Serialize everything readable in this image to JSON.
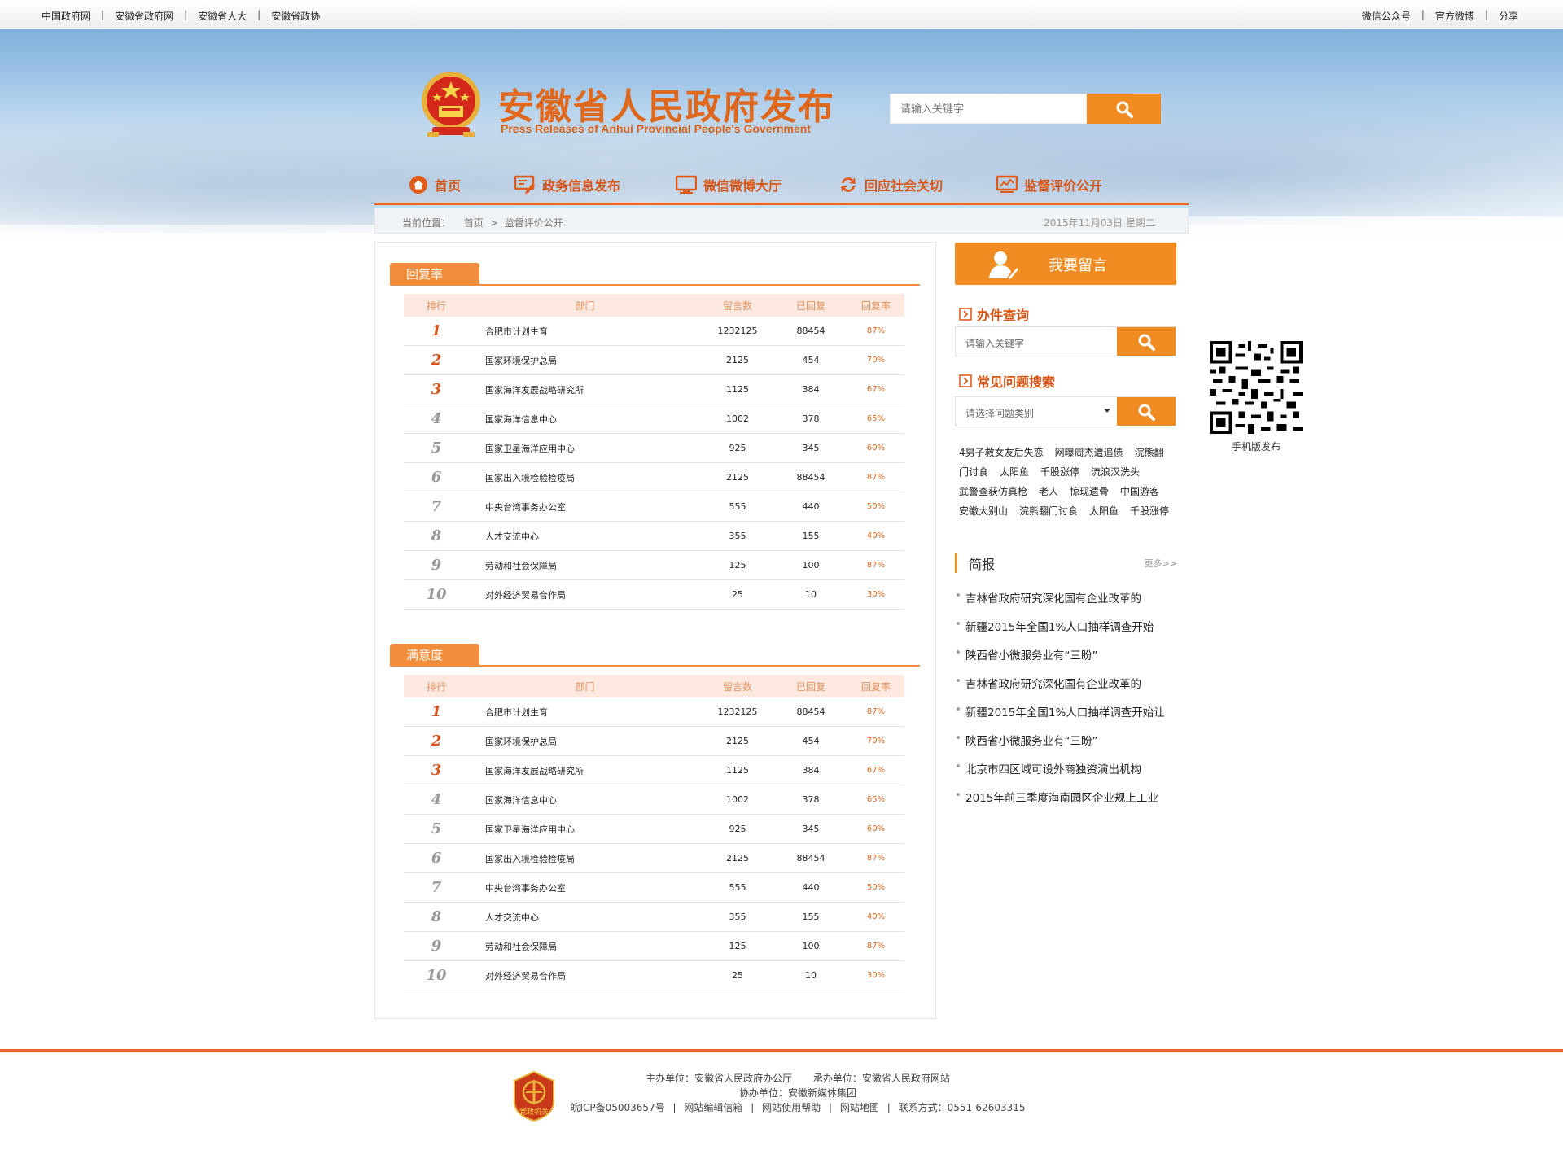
{
  "topbar": {
    "left_links": [
      "中国政府网",
      "安徽省政府网",
      "安徽省人大",
      "安徽省政协"
    ],
    "right_links": [
      "微信公众号",
      "官方微博",
      "分享"
    ]
  },
  "header": {
    "title": "安徽省人民政府发布",
    "subtitle": "Press Releases of Anhui Provincial People's Government",
    "search_placeholder": "请输入关键字"
  },
  "nav": [
    {
      "label": "首页",
      "icon": "home-icon"
    },
    {
      "label": "政务信息发布",
      "icon": "edit-icon"
    },
    {
      "label": "微信微博大厅",
      "icon": "monitor-icon"
    },
    {
      "label": "回应社会关切",
      "icon": "refresh-icon"
    },
    {
      "label": "监督评价公开",
      "icon": "chart-icon"
    }
  ],
  "breadcrumb": {
    "prefix": "当前位置：",
    "home": "首页",
    "sep": ">",
    "current": "监督评价公开",
    "date": "2015年11月03日  星期二"
  },
  "table_headers": {
    "rank": "排行",
    "dept": "部门",
    "messages": "留言数",
    "replied": "已回复",
    "rate": "回复率"
  },
  "sections": [
    {
      "title": "回复率",
      "rows": [
        {
          "rank": "1",
          "dept": "合肥市计划生育",
          "messages": "1232125",
          "replied": "88454",
          "rate": "87%"
        },
        {
          "rank": "2",
          "dept": "国家环境保护总局",
          "messages": "2125",
          "replied": "454",
          "rate": "70%"
        },
        {
          "rank": "3",
          "dept": "国家海洋发展战略研究所",
          "messages": "1125",
          "replied": "384",
          "rate": "67%"
        },
        {
          "rank": "4",
          "dept": "国家海洋信息中心",
          "messages": "1002",
          "replied": "378",
          "rate": "65%"
        },
        {
          "rank": "5",
          "dept": "国家卫星海洋应用中心",
          "messages": "925",
          "replied": "345",
          "rate": "60%"
        },
        {
          "rank": "6",
          "dept": "国家出入境检验检疫局",
          "messages": "2125",
          "replied": "88454",
          "rate": "87%"
        },
        {
          "rank": "7",
          "dept": "中央台湾事务办公室",
          "messages": "555",
          "replied": "440",
          "rate": "50%"
        },
        {
          "rank": "8",
          "dept": "人才交流中心",
          "messages": "355",
          "replied": "155",
          "rate": "40%"
        },
        {
          "rank": "9",
          "dept": "劳动和社会保障局",
          "messages": "125",
          "replied": "100",
          "rate": "87%"
        },
        {
          "rank": "10",
          "dept": "对外经济贸易合作局",
          "messages": "25",
          "replied": "10",
          "rate": "30%"
        }
      ]
    },
    {
      "title": "满意度",
      "rows": [
        {
          "rank": "1",
          "dept": "合肥市计划生育",
          "messages": "1232125",
          "replied": "88454",
          "rate": "87%"
        },
        {
          "rank": "2",
          "dept": "国家环境保护总局",
          "messages": "2125",
          "replied": "454",
          "rate": "70%"
        },
        {
          "rank": "3",
          "dept": "国家海洋发展战略研究所",
          "messages": "1125",
          "replied": "384",
          "rate": "67%"
        },
        {
          "rank": "4",
          "dept": "国家海洋信息中心",
          "messages": "1002",
          "replied": "378",
          "rate": "65%"
        },
        {
          "rank": "5",
          "dept": "国家卫星海洋应用中心",
          "messages": "925",
          "replied": "345",
          "rate": "60%"
        },
        {
          "rank": "6",
          "dept": "国家出入境检验检疫局",
          "messages": "2125",
          "replied": "88454",
          "rate": "87%"
        },
        {
          "rank": "7",
          "dept": "中央台湾事务办公室",
          "messages": "555",
          "replied": "440",
          "rate": "50%"
        },
        {
          "rank": "8",
          "dept": "人才交流中心",
          "messages": "355",
          "replied": "155",
          "rate": "40%"
        },
        {
          "rank": "9",
          "dept": "劳动和社会保障局",
          "messages": "125",
          "replied": "100",
          "rate": "87%"
        },
        {
          "rank": "10",
          "dept": "对外经济贸易合作局",
          "messages": "25",
          "replied": "10",
          "rate": "30%"
        }
      ]
    }
  ],
  "sidebar": {
    "leave_message": "我要留言",
    "case_query_title": "办件查询",
    "case_query_placeholder": "请输入关键字",
    "faq_title": "常见问题搜索",
    "faq_select": "请选择问题类别",
    "tags": [
      [
        "4男子救女友后失恋",
        "网曝周杰遭追债",
        "浣熊翻"
      ],
      [
        "门讨食",
        "太阳鱼",
        "千股涨停",
        "流浪汉洗头"
      ],
      [
        "武警查获仿真枪",
        "老人",
        "惊现遗骨",
        "中国游客"
      ],
      [
        "安徽大别山",
        "浣熊翻门讨食",
        "太阳鱼",
        "千股涨停"
      ]
    ],
    "brief_title": "简报",
    "brief_more": "更多>>",
    "brief_items": [
      "吉林省政府研究深化国有企业改革的",
      "新疆2015年全国1%人口抽样调查开始",
      "陕西省小微服务业有“三盼”",
      "吉林省政府研究深化国有企业改革的",
      "新疆2015年全国1%人口抽样调查开始让",
      "陕西省小微服务业有“三盼”",
      "北京市四区域可设外商独资演出机构",
      "2015年前三季度海南园区企业规上工业"
    ]
  },
  "qr_label": "手机版发布",
  "footer": {
    "logo_text": "党政机关",
    "host": "主办单位：安徽省人民政府办公厅",
    "organizer": "承办单位：安徽省人民政府网站",
    "co": "协办单位：安徽新媒体集团",
    "icp": "皖ICP备05003657号",
    "links": [
      "网站编辑信箱",
      "网站使用帮助",
      "网站地图"
    ],
    "contact": "联系方式：0551-62603315"
  },
  "colors": {
    "accent": "#f08c21",
    "brand": "#e0681d",
    "nav_line": "#e8662a"
  }
}
